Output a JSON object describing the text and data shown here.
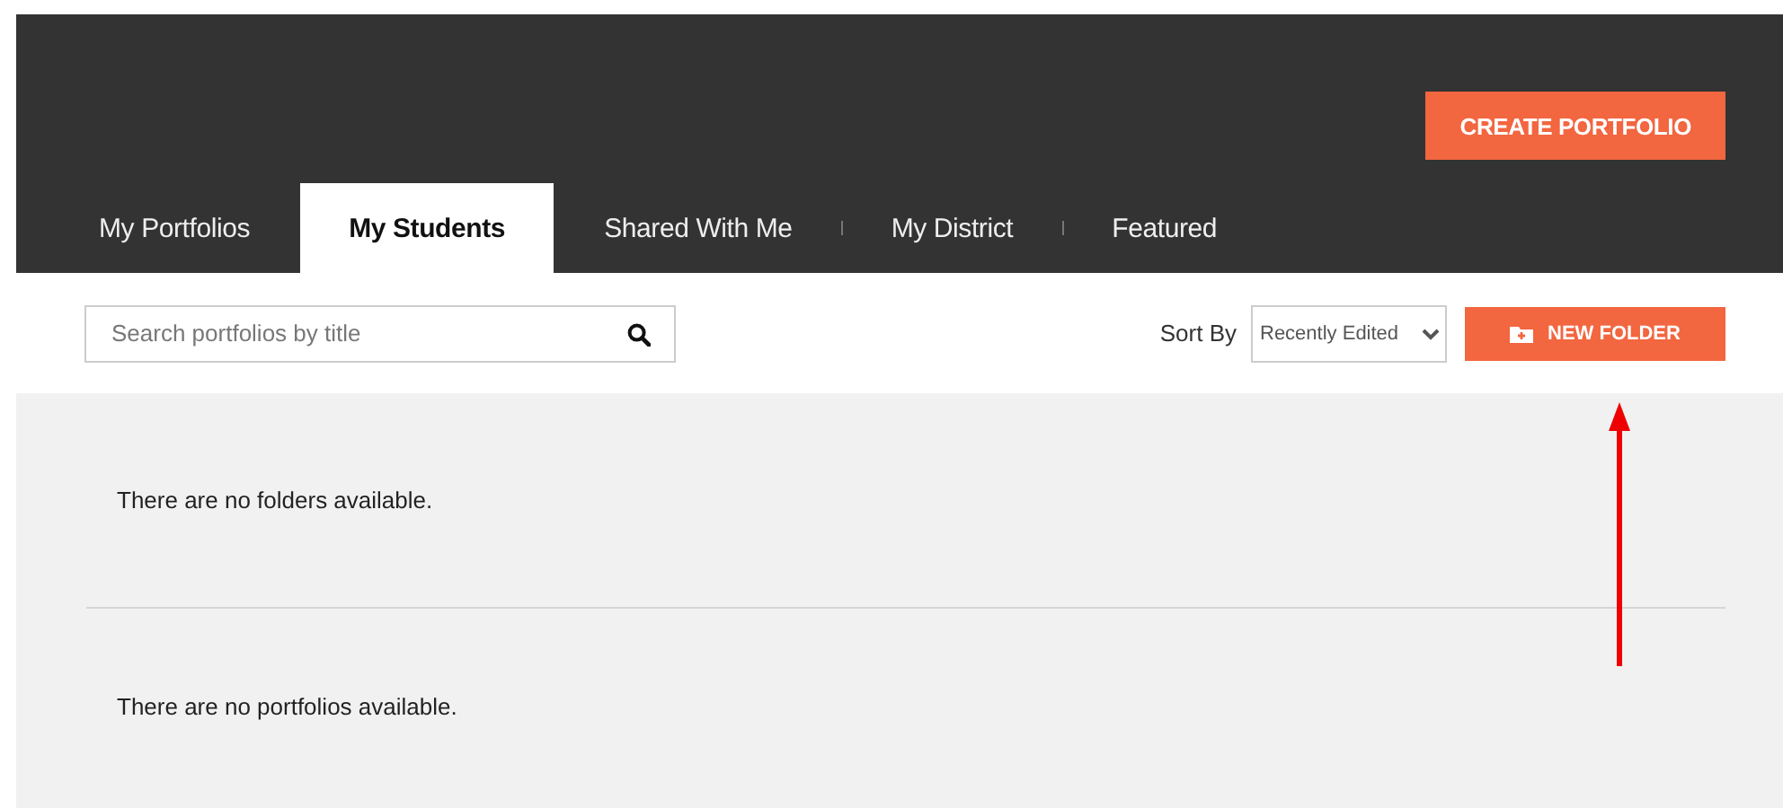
{
  "header": {
    "create_button": "CREATE PORTFOLIO"
  },
  "tabs": [
    {
      "label": "My Portfolios",
      "selected": false
    },
    {
      "label": "My Students",
      "selected": true
    },
    {
      "label": "Shared With Me",
      "selected": false
    },
    {
      "label": "My District",
      "selected": false
    },
    {
      "label": "Featured",
      "selected": false
    }
  ],
  "search": {
    "placeholder": "Search portfolios by title"
  },
  "sort": {
    "label": "Sort By",
    "value": "Recently Edited"
  },
  "new_folder_button": "NEW FOLDER",
  "messages": [
    "There are no folders available.",
    "There are no portfolios available."
  ]
}
